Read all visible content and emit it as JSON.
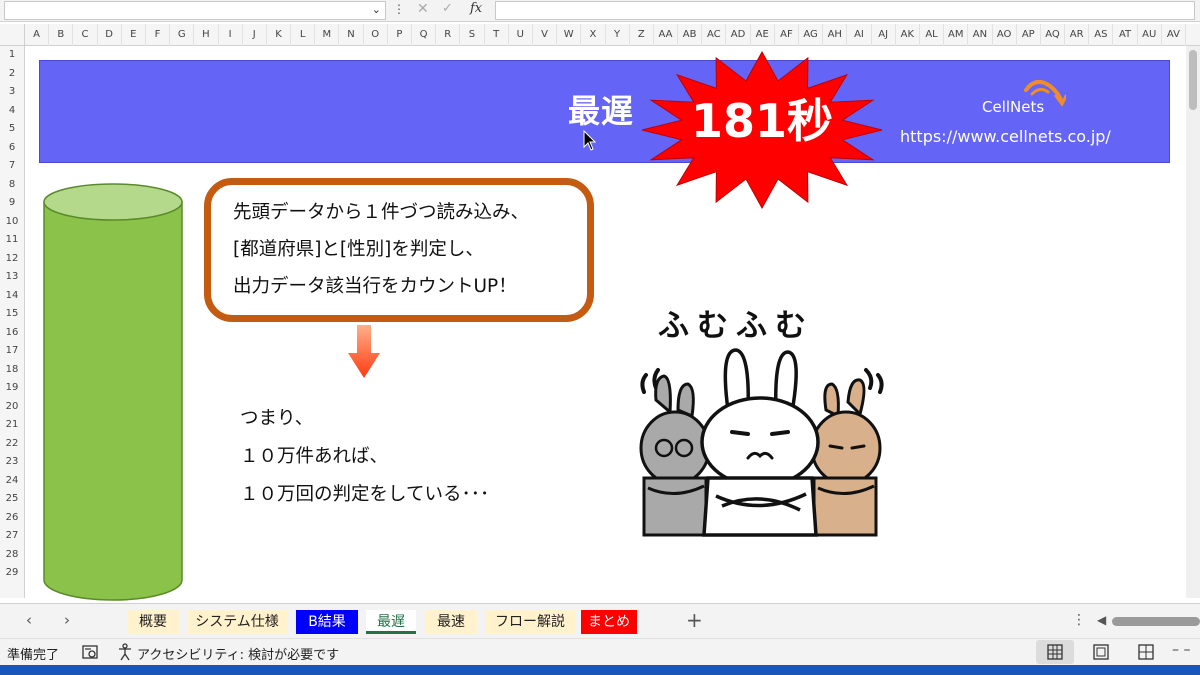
{
  "formula_bar": {
    "fx_label": "fx"
  },
  "columns": [
    "A",
    "B",
    "C",
    "D",
    "E",
    "F",
    "G",
    "H",
    "I",
    "J",
    "K",
    "L",
    "M",
    "N",
    "O",
    "P",
    "Q",
    "R",
    "S",
    "T",
    "U",
    "V",
    "W",
    "X",
    "Y",
    "Z",
    "AA",
    "AB",
    "AC",
    "AD",
    "AE",
    "AF",
    "AG",
    "AH",
    "AI",
    "AJ",
    "AK",
    "AL",
    "AM",
    "AN",
    "AO",
    "AP",
    "AQ",
    "AR",
    "AS",
    "AT",
    "AU",
    "AV"
  ],
  "rows": [
    "1",
    "2",
    "3",
    "4",
    "5",
    "6",
    "7",
    "8",
    "9",
    "10",
    "11",
    "12",
    "13",
    "14",
    "15",
    "16",
    "17",
    "18",
    "19",
    "20",
    "21",
    "22",
    "23",
    "24",
    "25",
    "26",
    "27",
    "28",
    "29"
  ],
  "banner": {
    "title": "最遅",
    "time": "181秒",
    "logo_text": "CellNets",
    "url": "https://www.cellnets.co.jp/"
  },
  "callout": {
    "lines": [
      "先頭データから１件づつ読み込み、",
      "[都道府県]と[性別]を判定し、",
      "出力データ該当行をカウントUP！"
    ]
  },
  "body": {
    "lines": [
      "つまり、",
      "１０万件あれば、",
      "１０万回の判定をしている･･･"
    ]
  },
  "illustration": {
    "caption": "ふむふむ"
  },
  "tabs": [
    {
      "label": "概要",
      "bg": "#fff2cc",
      "color": "#222222"
    },
    {
      "label": "システム仕様",
      "bg": "#fff2cc",
      "color": "#222222"
    },
    {
      "label": "B結果",
      "bg": "#0000ff",
      "color": "#ffffff"
    },
    {
      "label": "最遅",
      "bg": "#ffffff",
      "color": "#222222",
      "active": true
    },
    {
      "label": "最速",
      "bg": "#fff2cc",
      "color": "#222222"
    },
    {
      "label": "フロー解説",
      "bg": "#fff2cc",
      "color": "#222222"
    },
    {
      "label": "まとめ",
      "bg": "#ff0000",
      "color": "#ffffff"
    }
  ],
  "status": {
    "ready": "準備完了",
    "accessibility": "アクセシビリティ: 検討が必要です"
  },
  "colors": {
    "banner": "#6464f6",
    "starburst": "#ff0000",
    "callout_border": "#c55a11",
    "cylinder": "#8bc34a"
  }
}
